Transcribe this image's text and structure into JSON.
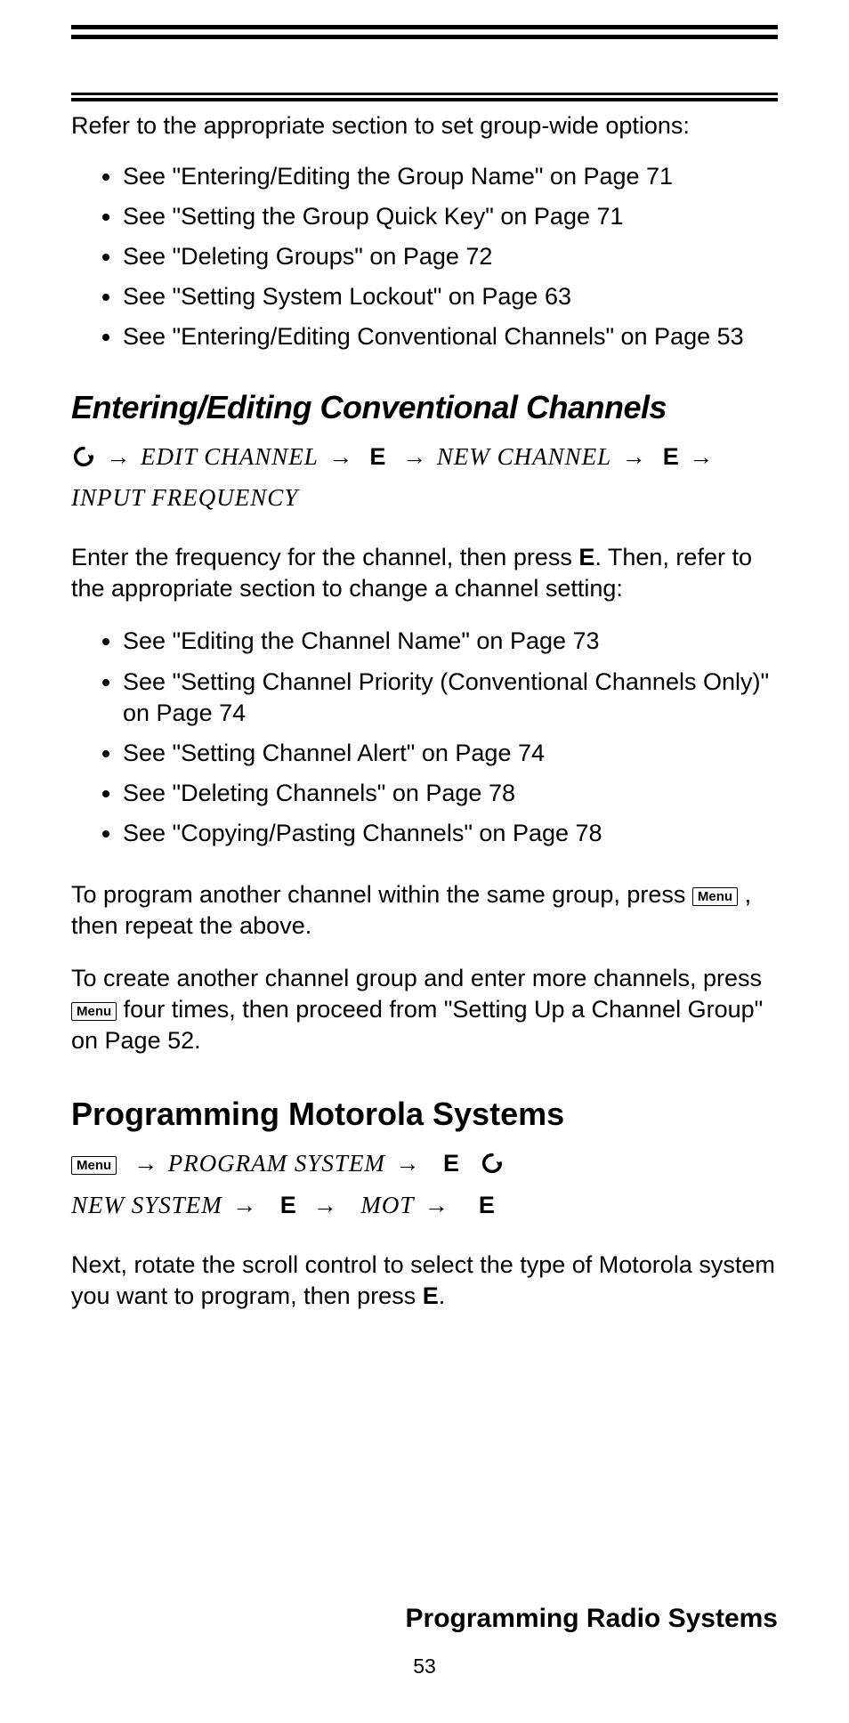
{
  "intro1": "Refer to the appropriate section to set group-wide options:",
  "list1": [
    "See \"Entering/Editing the Group Name\" on Page 71",
    "See \"Setting the Group Quick Key\" on Page 71",
    "See \"Deleting Groups\" on Page 72",
    "See \"Setting System Lockout\" on Page 63",
    "See \"Entering/Editing Conventional Channels\" on Page 53"
  ],
  "heading1": "Entering/Editing Conventional Channels",
  "path1": {
    "step1": "EDIT CHANNEL",
    "e1": "E",
    "step2": "NEW CHANNEL",
    "e2": "E",
    "step3": "INPUT FREQUENCY"
  },
  "para1_pre": "Enter the frequency for the channel, then press ",
  "para1_key": "E",
  "para1_post": ". Then, refer to the appropriate section to change a channel setting:",
  "list2": [
    "See \"Editing the Channel Name\" on Page 73",
    "See \"Setting Channel Priority (Conventional Channels Only)\" on Page 74",
    "See \"Setting Channel Alert\" on Page 74",
    "See \"Deleting Channels\" on Page 78",
    "See \"Copying/Pasting Channels\" on Page 78"
  ],
  "para2_pre": "To program another channel within the same group, press ",
  "menu_label": "Menu",
  "para2_post": " , then repeat the above.",
  "para3_pre": "To create another channel group and enter more channels, press ",
  "para3_post": " four times, then proceed from \"Setting Up a Channel Group\" on Page 52.",
  "heading2": "Programming Motorola Systems",
  "path2": {
    "step1": "PROGRAM SYSTEM",
    "e1": "E",
    "step2": "NEW SYSTEM",
    "e2": "E",
    "step3": "MOT",
    "e3": "E"
  },
  "para4_pre": "Next, rotate the scroll control to select the type of Motorola system you want to program, then press ",
  "para4_key": "E",
  "para4_post": ".",
  "footer": "Programming Radio Systems",
  "pagenum": "53"
}
